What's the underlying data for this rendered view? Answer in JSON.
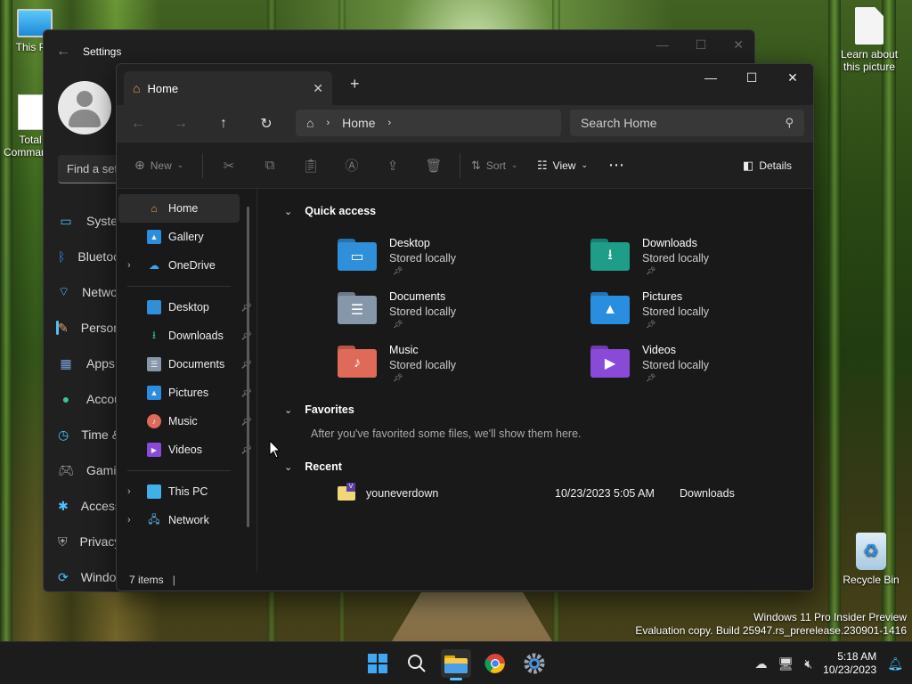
{
  "desktop": {
    "icons": [
      {
        "label": "This PC",
        "icon": "monitor-icon"
      },
      {
        "label": "Total Commander",
        "icon": "total-commander-icon"
      },
      {
        "label": "Learn about this picture",
        "icon": "document-icon"
      },
      {
        "label": "Recycle Bin",
        "icon": "recycle-bin-icon"
      }
    ],
    "watermark": {
      "line1": "Windows 11 Pro Insider Preview",
      "line2": "Evaluation copy. Build 25947.rs_prerelease.230901-1416"
    }
  },
  "settings": {
    "title": "Settings",
    "search_placeholder": "Find a setting",
    "nav": [
      {
        "label": "System",
        "icon": "system-icon",
        "color": "#4cc2ff"
      },
      {
        "label": "Bluetooth & devices",
        "icon": "bluetooth-icon",
        "color": "#3b8eea"
      },
      {
        "label": "Network & internet",
        "icon": "wifi-icon",
        "color": "#4cc2ff"
      },
      {
        "label": "Personalization",
        "icon": "brush-icon",
        "color": "#e8a060",
        "active": true
      },
      {
        "label": "Apps",
        "icon": "apps-icon",
        "color": "#7aa0d8"
      },
      {
        "label": "Accounts",
        "icon": "accounts-icon",
        "color": "#3fc09a"
      },
      {
        "label": "Time & language",
        "icon": "time-language-icon",
        "color": "#4cc2ff"
      },
      {
        "label": "Gaming",
        "icon": "gaming-icon",
        "color": "#aaaaaa"
      },
      {
        "label": "Accessibility",
        "icon": "accessibility-icon",
        "color": "#4cc2ff"
      },
      {
        "label": "Privacy & security",
        "icon": "shield-icon",
        "color": "#aaaaaa"
      },
      {
        "label": "Windows Update",
        "icon": "update-icon",
        "color": "#4cc2ff"
      }
    ]
  },
  "explorer": {
    "tab": {
      "title": "Home",
      "icon": "home-icon"
    },
    "address": {
      "crumb": "Home"
    },
    "search_placeholder": "Search Home",
    "toolbar": {
      "new_label": "New",
      "sort_label": "Sort",
      "view_label": "View",
      "details_label": "Details"
    },
    "nav_pane": {
      "top": [
        {
          "label": "Home",
          "icon": "home-icon",
          "selected": true
        },
        {
          "label": "Gallery",
          "icon": "gallery-icon"
        },
        {
          "label": "OneDrive",
          "icon": "onedrive-icon",
          "expandable": true
        }
      ],
      "pinned": [
        {
          "label": "Desktop",
          "icon": "desktop-folder-icon"
        },
        {
          "label": "Downloads",
          "icon": "downloads-folder-icon"
        },
        {
          "label": "Documents",
          "icon": "documents-folder-icon"
        },
        {
          "label": "Pictures",
          "icon": "pictures-folder-icon"
        },
        {
          "label": "Music",
          "icon": "music-folder-icon"
        },
        {
          "label": "Videos",
          "icon": "videos-folder-icon"
        }
      ],
      "bottom": [
        {
          "label": "This PC",
          "icon": "this-pc-icon"
        },
        {
          "label": "Network",
          "icon": "network-icon"
        }
      ]
    },
    "quick_access": {
      "header": "Quick access",
      "items": [
        {
          "name": "Desktop",
          "status": "Stored locally",
          "color": "#2f8fd8",
          "glyph": "▭"
        },
        {
          "name": "Downloads",
          "status": "Stored locally",
          "color": "#1e9e88",
          "glyph": "⭳"
        },
        {
          "name": "Documents",
          "status": "Stored locally",
          "color": "#8797aa",
          "glyph": "☰"
        },
        {
          "name": "Pictures",
          "status": "Stored locally",
          "color": "#2a8ee0",
          "glyph": "▲"
        },
        {
          "name": "Music",
          "status": "Stored locally",
          "color": "#e06a5a",
          "glyph": "♪"
        },
        {
          "name": "Videos",
          "status": "Stored locally",
          "color": "#8a4ad8",
          "glyph": "▶"
        }
      ]
    },
    "favorites": {
      "header": "Favorites",
      "empty_note": "After you've favorited some files, we'll show them here."
    },
    "recent": {
      "header": "Recent",
      "items": [
        {
          "name": "youneverdown",
          "date": "10/23/2023 5:05 AM",
          "location": "Downloads"
        }
      ]
    },
    "status": {
      "item_count": "7 items"
    }
  },
  "taskbar": {
    "apps": [
      {
        "name": "start",
        "icon": "windows-logo-icon"
      },
      {
        "name": "search",
        "icon": "search-icon"
      },
      {
        "name": "file-explorer",
        "icon": "folder-icon",
        "active": true
      },
      {
        "name": "chrome",
        "icon": "chrome-icon"
      },
      {
        "name": "settings",
        "icon": "gear-icon"
      }
    ],
    "clock": {
      "time": "5:18 AM",
      "date": "10/23/2023"
    }
  }
}
